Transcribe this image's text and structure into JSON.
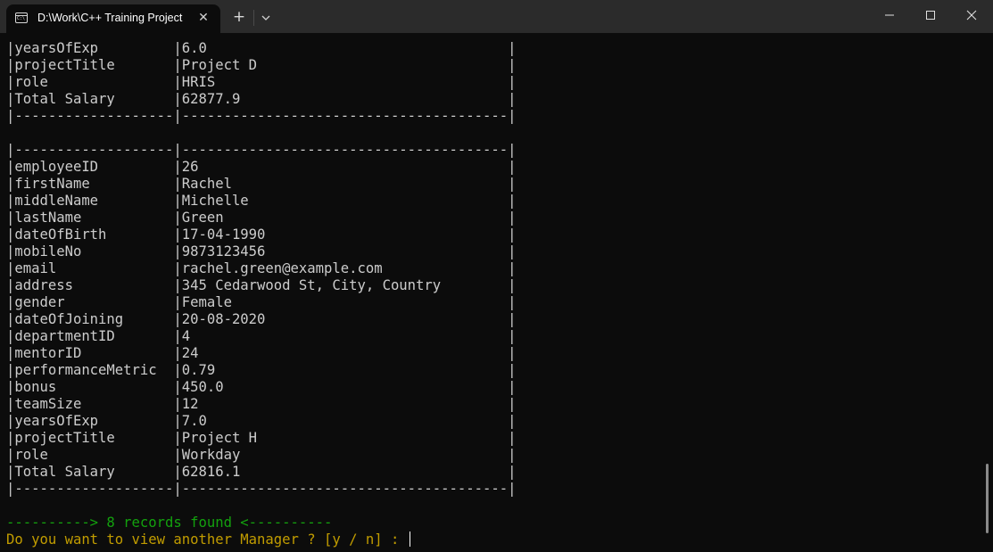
{
  "window": {
    "tab_title": "D:\\Work\\C++ Training Project",
    "tab_icon": "terminal-icon",
    "new_tab_label": "+",
    "close_tab_label": "✕",
    "controls": [
      "minimize-icon",
      "maximize-icon",
      "close-icon"
    ]
  },
  "terminal": {
    "prev_record": [
      {
        "field": "yearsOfExp",
        "value": "6.0"
      },
      {
        "field": "projectTitle",
        "value": "Project D"
      },
      {
        "field": "role",
        "value": "HRIS"
      },
      {
        "field": "Total Salary",
        "value": "62877.9"
      }
    ],
    "record": [
      {
        "field": "employeeID",
        "value": "26"
      },
      {
        "field": "firstName",
        "value": "Rachel"
      },
      {
        "field": "middleName",
        "value": "Michelle"
      },
      {
        "field": "lastName",
        "value": "Green"
      },
      {
        "field": "dateOfBirth",
        "value": "17-04-1990"
      },
      {
        "field": "mobileNo",
        "value": "9873123456"
      },
      {
        "field": "email",
        "value": "rachel.green@example.com"
      },
      {
        "field": "address",
        "value": "345 Cedarwood St, City, Country"
      },
      {
        "field": "gender",
        "value": "Female"
      },
      {
        "field": "dateOfJoining",
        "value": "20-08-2020"
      },
      {
        "field": "departmentID",
        "value": "4"
      },
      {
        "field": "mentorID",
        "value": "24"
      },
      {
        "field": "performanceMetric",
        "value": "0.79"
      },
      {
        "field": "bonus",
        "value": "450.0"
      },
      {
        "field": "teamSize",
        "value": "12"
      },
      {
        "field": "yearsOfExp",
        "value": "7.0"
      },
      {
        "field": "projectTitle",
        "value": "Project H"
      },
      {
        "field": "role",
        "value": "Workday"
      },
      {
        "field": "Total Salary",
        "value": "62816.1"
      }
    ],
    "records_found": "----------> 8 records found <----------",
    "prompt": "Do you want to view another Manager ? [y / n] : ",
    "colors": {
      "background": "#0c0c0c",
      "text": "#cccccc",
      "success": "#13a10e",
      "prompt": "#c19c00"
    }
  }
}
